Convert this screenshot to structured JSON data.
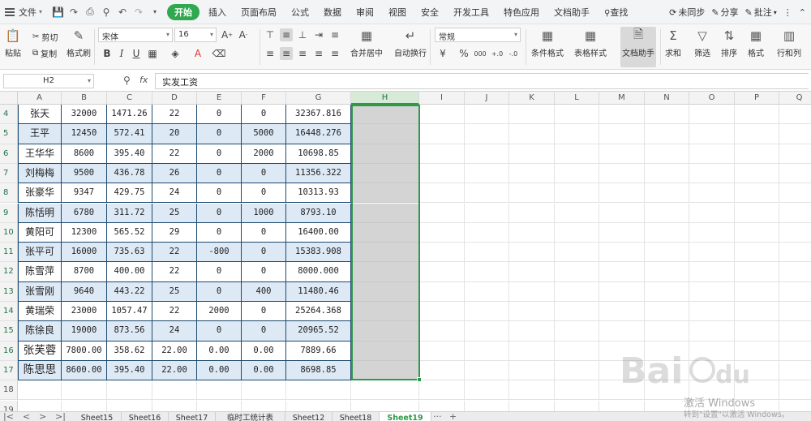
{
  "menubar": {
    "file_label": "文件",
    "tabs": [
      {
        "label": "开始",
        "active": true
      },
      {
        "label": "插入"
      },
      {
        "label": "页面布局"
      },
      {
        "label": "公式"
      },
      {
        "label": "数据"
      },
      {
        "label": "审阅"
      },
      {
        "label": "视图"
      },
      {
        "label": "安全"
      },
      {
        "label": "开发工具"
      },
      {
        "label": "特色应用"
      },
      {
        "label": "文档助手"
      },
      {
        "label": "查找"
      }
    ],
    "right": {
      "sync": "未同步",
      "share": "分享",
      "comment": "批注"
    },
    "active_color": "#2fa84f"
  },
  "ribbon": {
    "paste": "粘贴",
    "cut": "剪切",
    "copy": "复制",
    "format_painter": "格式刷",
    "font_name": "宋体",
    "font_size": "16",
    "merge_center": "合并居中",
    "wrap_text": "自动换行",
    "number_format": "常规",
    "conditional_format": "条件格式",
    "table_style": "表格样式",
    "doc_assistant": "文档助手",
    "sum": "求和",
    "filter": "筛选",
    "sort": "排序",
    "format": "格式",
    "rows_cols": "行和列"
  },
  "formula_bar": {
    "name_box": "H2",
    "fx": "fx",
    "content": "实发工资"
  },
  "columns": [
    "A",
    "B",
    "C",
    "D",
    "E",
    "F",
    "G",
    "H",
    "I",
    "J",
    "K",
    "L",
    "M",
    "N",
    "O",
    "P",
    "Q"
  ],
  "selected_column": "H",
  "rows": [
    {
      "num": "4",
      "cells": [
        "张天",
        "32000",
        "1471.26",
        "22",
        "0",
        "0",
        "32367.816"
      ]
    },
    {
      "num": "5",
      "cells": [
        "王平",
        "12450",
        "572.41",
        "20",
        "0",
        "5000",
        "16448.276"
      ]
    },
    {
      "num": "6",
      "cells": [
        "王华华",
        "8600",
        "395.40",
        "22",
        "0",
        "2000",
        "10698.85"
      ]
    },
    {
      "num": "7",
      "cells": [
        "刘梅梅",
        "9500",
        "436.78",
        "26",
        "0",
        "0",
        "11356.322"
      ]
    },
    {
      "num": "8",
      "cells": [
        "张豪华",
        "9347",
        "429.75",
        "24",
        "0",
        "0",
        "10313.93"
      ]
    },
    {
      "num": "9",
      "cells": [
        "陈恬明",
        "6780",
        "311.72",
        "25",
        "0",
        "1000",
        "8793.10"
      ]
    },
    {
      "num": "10",
      "cells": [
        "黄阳可",
        "12300",
        "565.52",
        "29",
        "0",
        "0",
        "16400.00"
      ]
    },
    {
      "num": "11",
      "cells": [
        "张平可",
        "16000",
        "735.63",
        "22",
        "-800",
        "0",
        "15383.908"
      ]
    },
    {
      "num": "12",
      "cells": [
        "陈雪萍",
        "8700",
        "400.00",
        "22",
        "0",
        "0",
        "8000.000"
      ]
    },
    {
      "num": "13",
      "cells": [
        "张雪刚",
        "9640",
        "443.22",
        "25",
        "0",
        "400",
        "11480.46"
      ]
    },
    {
      "num": "14",
      "cells": [
        "黄瑞荣",
        "23000",
        "1057.47",
        "22",
        "2000",
        "0",
        "25264.368"
      ]
    },
    {
      "num": "15",
      "cells": [
        "陈徐良",
        "19000",
        "873.56",
        "24",
        "0",
        "0",
        "20965.52"
      ]
    },
    {
      "num": "16",
      "cells": [
        "张芙蓉",
        "7800.00",
        "358.62",
        "22.00",
        "0.00",
        "0.00",
        "7889.66"
      ]
    },
    {
      "num": "17",
      "cells": [
        "陈思思",
        "8600.00",
        "395.40",
        "22.00",
        "0.00",
        "0.00",
        "8698.85"
      ]
    },
    {
      "num": "18",
      "cells": []
    },
    {
      "num": "19",
      "cells": []
    }
  ],
  "sheet_tabs": [
    {
      "label": "Sheet15"
    },
    {
      "label": "Sheet16"
    },
    {
      "label": "Sheet17"
    },
    {
      "label": "临时工统计表"
    },
    {
      "label": "Sheet12"
    },
    {
      "label": "Sheet18"
    },
    {
      "label": "Sheet19",
      "active": true
    }
  ],
  "watermark": {
    "activate_title": "激活 Windows",
    "activate_sub": "转到\"设置\"以激活 Windows。"
  },
  "colors": {
    "selection_green": "#2e9a48",
    "row_band_blue": "#dde9f5",
    "table_border": "#1e4a6e"
  }
}
